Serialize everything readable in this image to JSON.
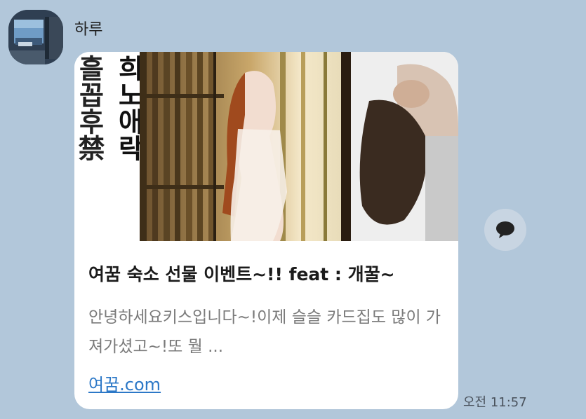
{
  "sender": {
    "name": "하루"
  },
  "card": {
    "thumbnail": {
      "calligraphy_left": "흘꼽후禁",
      "calligraphy_right": "희노애락"
    },
    "title": "여꿈 숙소 선물 이벤트~!! feat : 개꿀~",
    "description": "안녕하세요키스입니다~!이제 슬슬 카드집도 많이 가져가셨고~!또 뭘 ...",
    "link": "여꿈.com"
  },
  "timestamp": "오전 11:57",
  "icons": {
    "share": "speech-bubble-icon",
    "avatar": "avatar-photo"
  },
  "colors": {
    "background": "#b2c7da",
    "link": "#2c78c7",
    "card": "#ffffff"
  }
}
